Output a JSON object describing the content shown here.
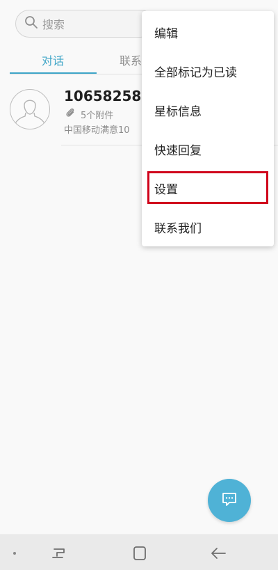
{
  "search": {
    "placeholder": "搜索"
  },
  "tabs": [
    {
      "label": "对话",
      "active": true
    },
    {
      "label": "联系"
    }
  ],
  "conversations": [
    {
      "name": "10658258",
      "attachments": "5个附件",
      "preview": "中国移动满意10"
    }
  ],
  "menu": {
    "items": [
      {
        "label": "编辑"
      },
      {
        "label": "全部标记为已读"
      },
      {
        "label": "星标信息"
      },
      {
        "label": "快速回复"
      },
      {
        "label": "设置",
        "highlighted": true
      },
      {
        "label": "联系我们"
      }
    ]
  },
  "colors": {
    "accent": "#3ea5c7",
    "fab": "#4fb2d6",
    "highlight": "#d0021b"
  },
  "icons": {
    "search": "search-icon",
    "avatar": "person-icon",
    "attachment": "paperclip-icon",
    "fab": "chat-icon",
    "nav_recent": "recent-apps-icon",
    "nav_home": "home-icon",
    "nav_back": "back-icon"
  }
}
